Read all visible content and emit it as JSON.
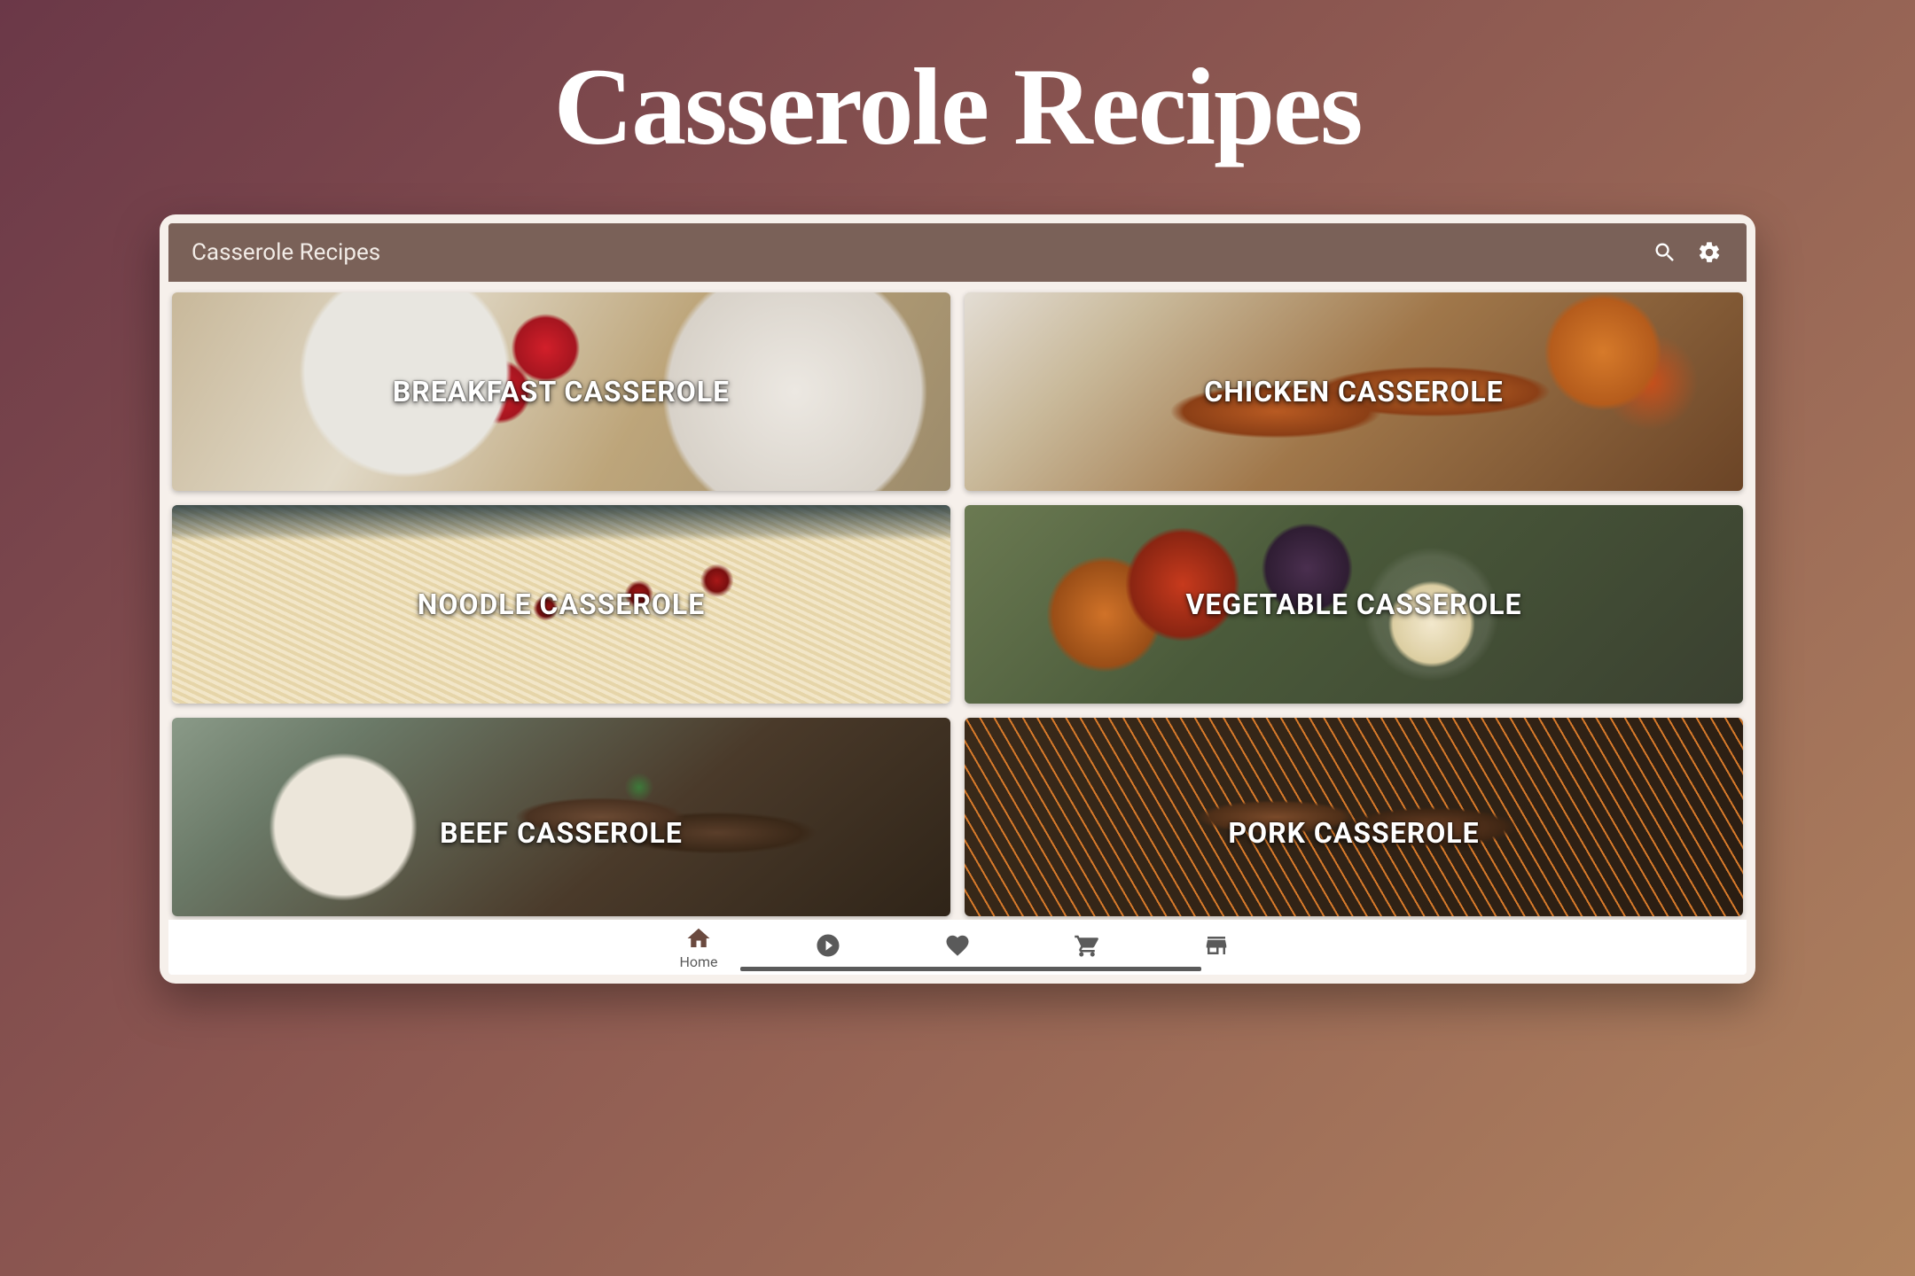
{
  "page_title": "Casserole Recipes",
  "app": {
    "topbar_title": "Casserole Recipes"
  },
  "cards": [
    {
      "label": "BREAKFAST CASSEROLE"
    },
    {
      "label": "CHICKEN CASSEROLE"
    },
    {
      "label": "NOODLE CASSEROLE"
    },
    {
      "label": "VEGETABLE CASSEROLE"
    },
    {
      "label": "BEEF CASSEROLE"
    },
    {
      "label": "PORK CASSEROLE"
    }
  ],
  "nav": {
    "home_label": "Home"
  }
}
